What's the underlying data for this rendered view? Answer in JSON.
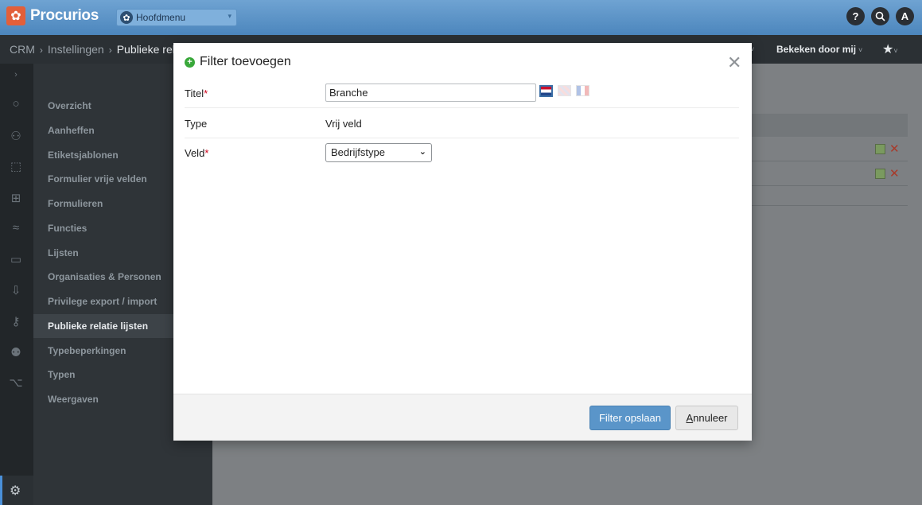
{
  "app": {
    "logo_text": "Procurios",
    "main_menu_label": "Hoofdmenu"
  },
  "topbar": {
    "help_label": "?",
    "avatar_initial": "A"
  },
  "breadcrumb": {
    "items": [
      "CRM",
      "Instellingen"
    ],
    "current": "Publieke rela"
  },
  "breadcrumb_right": {
    "viewed_label": "Bekeken door mij",
    "star": "★"
  },
  "sidebar": {
    "items": [
      {
        "label": "Overzicht"
      },
      {
        "label": "Aanheffen"
      },
      {
        "label": "Etiketsjablonen"
      },
      {
        "label": "Formulier vrije velden"
      },
      {
        "label": "Formulieren"
      },
      {
        "label": "Functies"
      },
      {
        "label": "Lijsten"
      },
      {
        "label": "Organisaties & Personen"
      },
      {
        "label": "Privilege export / import"
      },
      {
        "label": "Publieke relatie lijsten"
      },
      {
        "label": "Typebeperkingen"
      },
      {
        "label": "Typen"
      },
      {
        "label": "Weergaven"
      }
    ],
    "active_index": 9
  },
  "modal": {
    "title": "Filter toevoegen",
    "fields": {
      "title_label": "Titel",
      "title_value": "Branche",
      "type_label": "Type",
      "type_value": "Vrij veld",
      "field_label": "Veld",
      "field_value": "Bedrijfstype"
    },
    "required_mark": "*",
    "save_button": "Filter opslaan",
    "cancel_button_first": "A",
    "cancel_button_rest": "nnuleer"
  },
  "colors": {
    "accent": "#5a95c9",
    "topbar": "#4c86bd",
    "required": "#d0021b"
  }
}
